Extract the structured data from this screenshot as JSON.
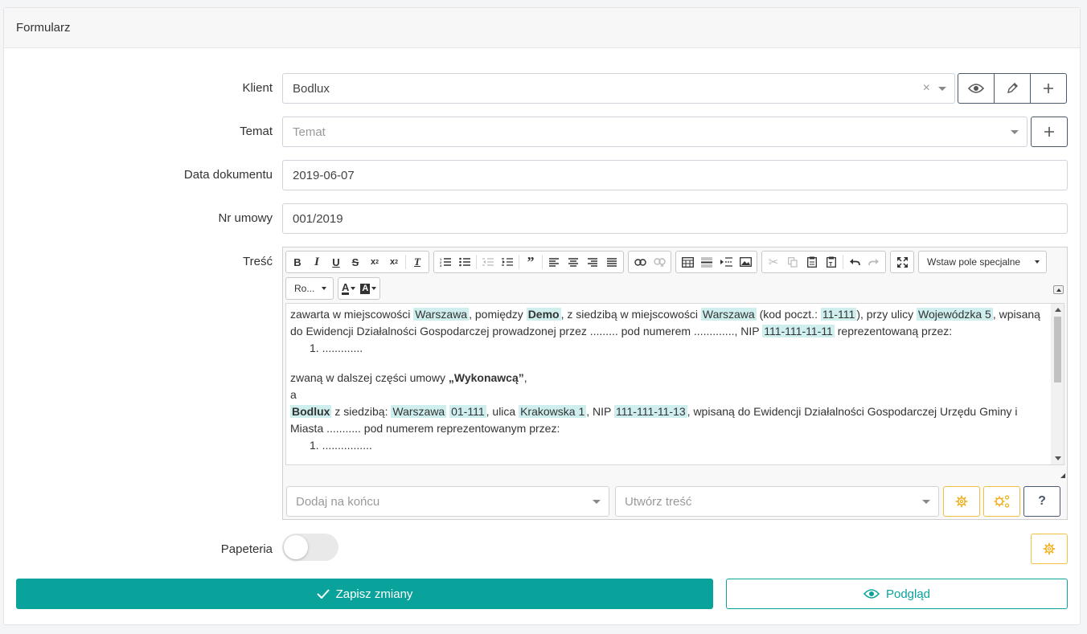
{
  "card": {
    "title": "Formularz"
  },
  "form": {
    "client": {
      "label": "Klient",
      "value": "Bodlux",
      "clear": "×"
    },
    "topic": {
      "label": "Temat",
      "placeholder": "Temat"
    },
    "doc_date": {
      "label": "Data dokumentu",
      "value": "2019-06-07"
    },
    "contract_no": {
      "label": "Nr umowy",
      "value": "001/2019"
    },
    "content": {
      "label": "Treść"
    },
    "stationery": {
      "label": "Papeteria",
      "enabled": false
    }
  },
  "editor": {
    "toolbar_row1": [
      [
        "bold-icon",
        "italic-icon",
        "underline-icon",
        "strikethrough-icon",
        "subscript-icon",
        "superscript-icon",
        "remove-format-icon"
      ],
      [
        "numbered-list-icon",
        "bulleted-list-icon",
        "outdent-icon",
        "indent-icon",
        "blockquote-icon",
        "align-left-icon",
        "align-center-icon",
        "align-right-icon",
        "justify-icon"
      ],
      [
        "link-icon",
        "unlink-icon"
      ],
      [
        "table-icon",
        "horizontal-rule-icon",
        "page-break-icon",
        "image-icon"
      ],
      [
        "cut-icon",
        "copy-icon",
        "paste-icon",
        "paste-text-icon",
        "undo-icon",
        "redo-icon"
      ],
      [
        "maximize-icon"
      ]
    ],
    "special_field_combo": "Wstaw pole specjalne",
    "font_combo": "Ro...",
    "text_color_glyph": "A",
    "bg_color_glyph": "A",
    "body": {
      "p1": {
        "t1": "zawarta w miejscowości ",
        "h1": "Warszawa",
        "t2": ", pomiędzy ",
        "h2": "Demo",
        "t3": ", z siedzibą w miejscowości ",
        "h3": "Warszawa",
        "t4": " (kod poczt.: ",
        "h4": "11-111",
        "t5": "), przy ulicy ",
        "h5": "Wojewódzka 5",
        "t6": ", wpisaną do Ewidencji Działalności Gospodarczej prowadzonej przez ......... pod numerem ............., NIP ",
        "h6": "111-111-11-11",
        "t7": " reprezentowaną przez:"
      },
      "list1_item": "1.  .............",
      "p2_pre": "zwaną w dalszej części umowy ",
      "p2_bold": "„Wykonawcą”",
      "p2_post": ",",
      "p3": "a",
      "p4": {
        "h1": "Bodlux",
        "t1": " z siedzibą: ",
        "h2": "Warszawa",
        "t2": " ",
        "h3": "01-111",
        "t3": ", ulica ",
        "h4": "Krakowska 1",
        "t4": ", NIP ",
        "h5": "111-111-11-13",
        "t5": ", wpisaną do Ewidencji Działalności Gospodarczej Urzędu Gminy i Miasta ........... pod numerem reprezentowanym przez:"
      },
      "list2_item": "1.  ................"
    },
    "add_at_end": {
      "placeholder": "Dodaj na końcu"
    },
    "create_content": {
      "placeholder": "Utwórz treść"
    },
    "help_glyph": "?"
  },
  "actions": {
    "save": "Zapisz zmiany",
    "preview": "Podgląd"
  },
  "colors": {
    "primary": "#0aa39b",
    "warning": "#f0b020",
    "highlight": "#cfeeee"
  }
}
